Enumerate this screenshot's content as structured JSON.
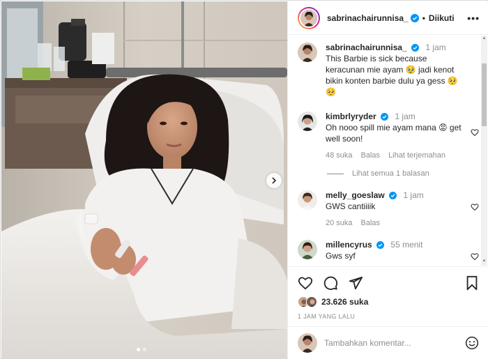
{
  "header": {
    "username": "sabrinachairunnisa_",
    "separator": "•",
    "follow_label": "Diikuti",
    "more_label": "•••"
  },
  "caption": {
    "username": "sabrinachairunnisa_",
    "time": "1 jam",
    "text": "This Barbie is sick because keracunan mie ayam 🥹 jadi kenot bikin konten barbie dulu ya gess 🥺🥺"
  },
  "comments": [
    {
      "username": "kimbrlyryder",
      "time": "1 jam",
      "text": "Oh nooo spill mie ayam mana 😡 get well soon!",
      "likes": "48 suka",
      "reply": "Balas",
      "translate": "Lihat terjemahan",
      "view_replies": "Lihat semua 1 balasan"
    },
    {
      "username": "melly_goeslaw",
      "time": "1 jam",
      "text": "GWS cantiiiik",
      "likes": "20 suka",
      "reply": "Balas"
    },
    {
      "username": "millencyrus",
      "time": "55 menit",
      "text": "Gws syf"
    }
  ],
  "actions": {
    "likes_count": "23.626 suka",
    "time_ago": "1 JAM YANG LALU"
  },
  "add_comment": {
    "placeholder": "Tambahkan komentar..."
  },
  "icons": {
    "verified": "verified-badge-icon",
    "like": "heart-icon",
    "comment": "comment-bubble-icon",
    "share": "paper-plane-icon",
    "save": "bookmark-icon",
    "emoji": "emoji-smile-icon",
    "next": "chevron-right-icon"
  },
  "colors": {
    "verified": "#0095f6",
    "muted": "#8e8e8e",
    "text": "#262626"
  }
}
